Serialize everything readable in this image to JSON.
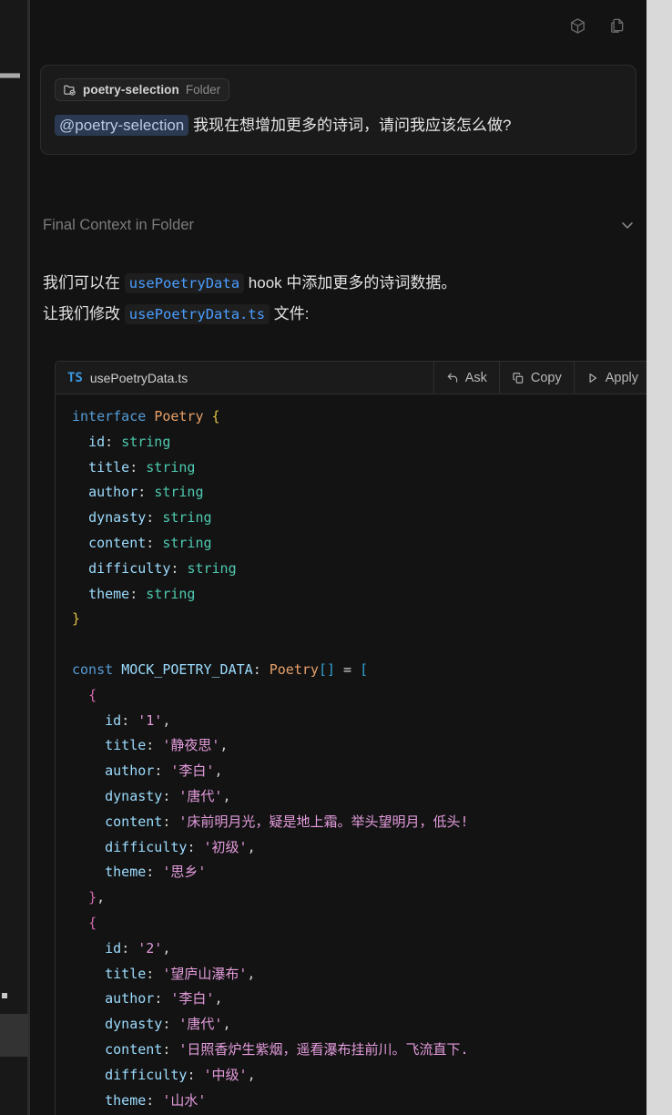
{
  "header": {
    "icons": [
      {
        "name": "cube-icon",
        "label": "Model / context cube"
      },
      {
        "name": "copy-pages-icon",
        "label": "Duplicate page"
      }
    ]
  },
  "user_message": {
    "context_chip": {
      "icon": "folder-check-icon",
      "name": "poetry-selection",
      "kind": "Folder"
    },
    "mention": "@poetry-selection",
    "text": "我现在想增加更多的诗词，请问我应该怎么做?"
  },
  "context_section": {
    "label": "Final Context in Folder",
    "chevron": "chevron-down-icon",
    "expanded": false
  },
  "assistant": {
    "paragraph": {
      "line1_before": "我们可以在 ",
      "line1_code": "usePoetryData",
      "line1_after": " hook 中添加更多的诗词数据。",
      "line2_before": "让我们修改 ",
      "line2_code": "usePoetryData.ts",
      "line2_after": " 文件:"
    }
  },
  "code_block": {
    "language_badge": "TS",
    "filename": "usePoetryData.ts",
    "actions": [
      {
        "name": "ask-button",
        "label": "Ask",
        "icon": "arrow-return-icon"
      },
      {
        "name": "copy-button",
        "label": "Copy",
        "icon": "copy-icon"
      },
      {
        "name": "apply-button",
        "label": "Apply",
        "icon": "play-triangle-icon"
      }
    ],
    "code_lines": [
      "interface Poetry {",
      "  id: string",
      "  title: string",
      "  author: string",
      "  dynasty: string",
      "  content: string",
      "  difficulty: string",
      "  theme: string",
      "}",
      "",
      "const MOCK_POETRY_DATA: Poetry[] = [",
      "  {",
      "    id: '1',",
      "    title: '静夜思',",
      "    author: '李白',",
      "    dynasty: '唐代',",
      "    content: '床前明月光，疑是地上霜。举头望明月，低头!",
      "    difficulty: '初级',",
      "    theme: '思乡'",
      "  },",
      "  {",
      "    id: '2',",
      "    title: '望庐山瀑布',",
      "    author: '李白',",
      "    dynasty: '唐代',",
      "    content: '日照香炉生紫烟，遥看瀑布挂前川。飞流直下.",
      "    difficulty: '中级',",
      "    theme: '山水'"
    ]
  },
  "colors": {
    "panel_background": "#131313",
    "bubble_background": "#1a1a1a",
    "mention_background": "#2b3a52",
    "mention_text": "#b9c9e0",
    "inline_code_text": "#4a9eff",
    "ts_badge": "#3b9ae1",
    "keyword": "#569cd6",
    "type": "#4ec9b0",
    "class_name": "#e8a06a",
    "property": "#9cdcfe",
    "string": "#e39bdc",
    "muted_text": "#7b7b7b",
    "right_strip": "#d9d9d9"
  }
}
